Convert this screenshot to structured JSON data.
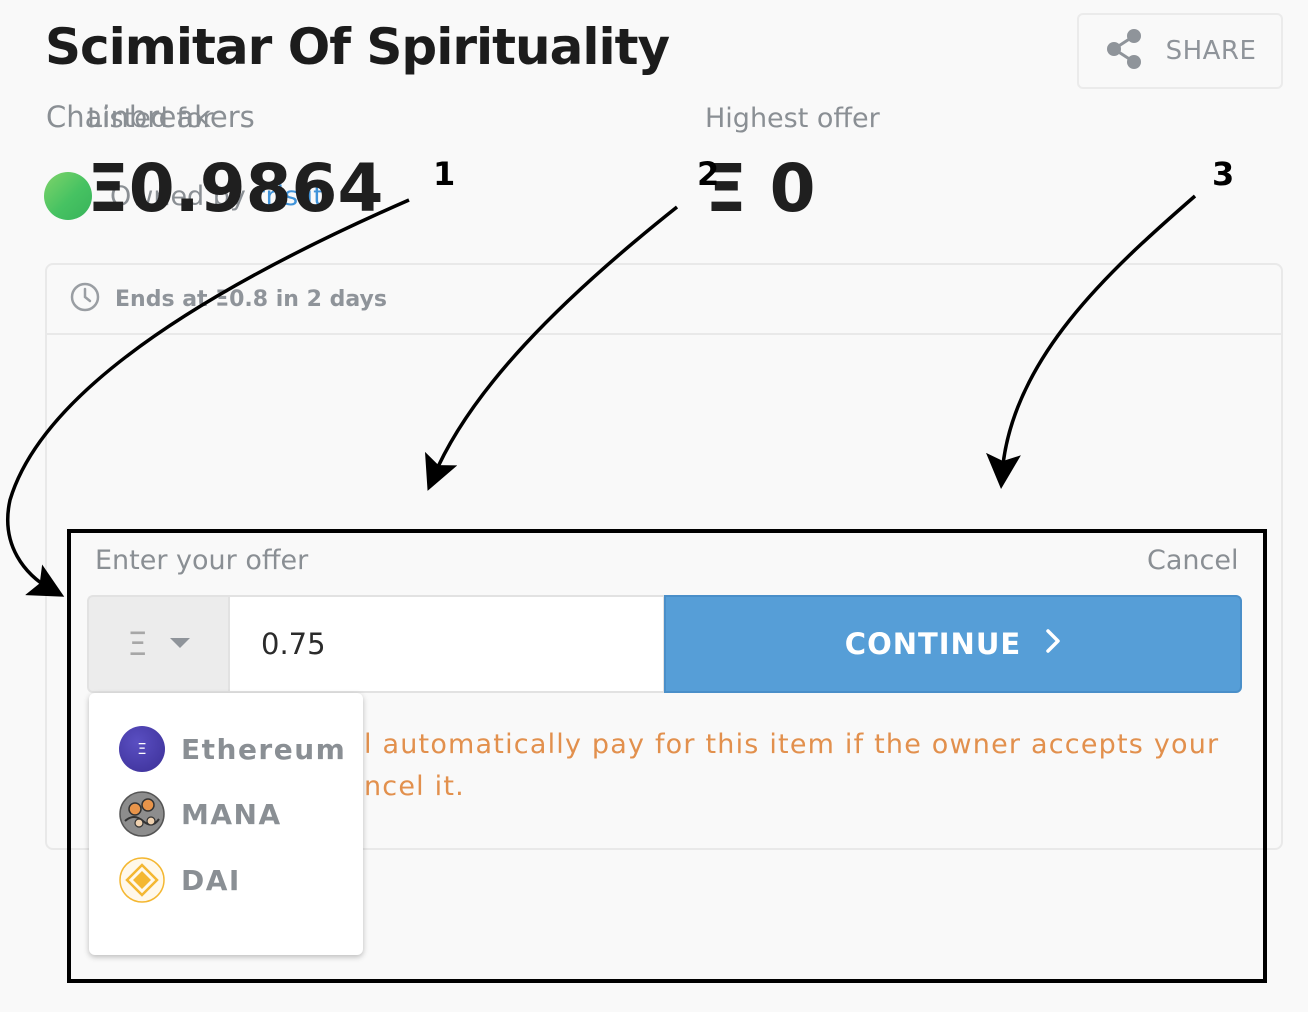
{
  "item": {
    "title": "Scimitar Of Spirituality",
    "collection": "Chainbreakers",
    "owned_by_label": "Owned by",
    "owner": "trislit"
  },
  "share": {
    "label": "SHARE",
    "icon": "share-icon"
  },
  "listing": {
    "ends_text": "Ends at Ξ0.8 in 2 days",
    "listed_label": "Listed for",
    "listed_price": "Ξ0.9864",
    "highest_label": "Highest offer",
    "highest_price": "Ξ 0"
  },
  "offer": {
    "label": "Enter your offer",
    "cancel": "Cancel",
    "currency_symbol": "Ξ",
    "amount": "0.75",
    "continue_label": "CONTINUE",
    "warning_line1": "l automatically pay for this item if the owner accepts your",
    "warning_line2": "ncel it."
  },
  "currency_options": [
    {
      "label": "Ethereum",
      "icon": "ethereum-icon",
      "symbol": "Ξ"
    },
    {
      "label": "MANA",
      "icon": "mana-icon"
    },
    {
      "label": "DAI",
      "icon": "dai-icon"
    }
  ],
  "callouts": [
    "1",
    "2",
    "3"
  ],
  "colors": {
    "accent_blue": "#569ed7",
    "link_blue": "#3f93d9",
    "warning_orange": "#e2904d",
    "avatar_green": "#46c262"
  }
}
